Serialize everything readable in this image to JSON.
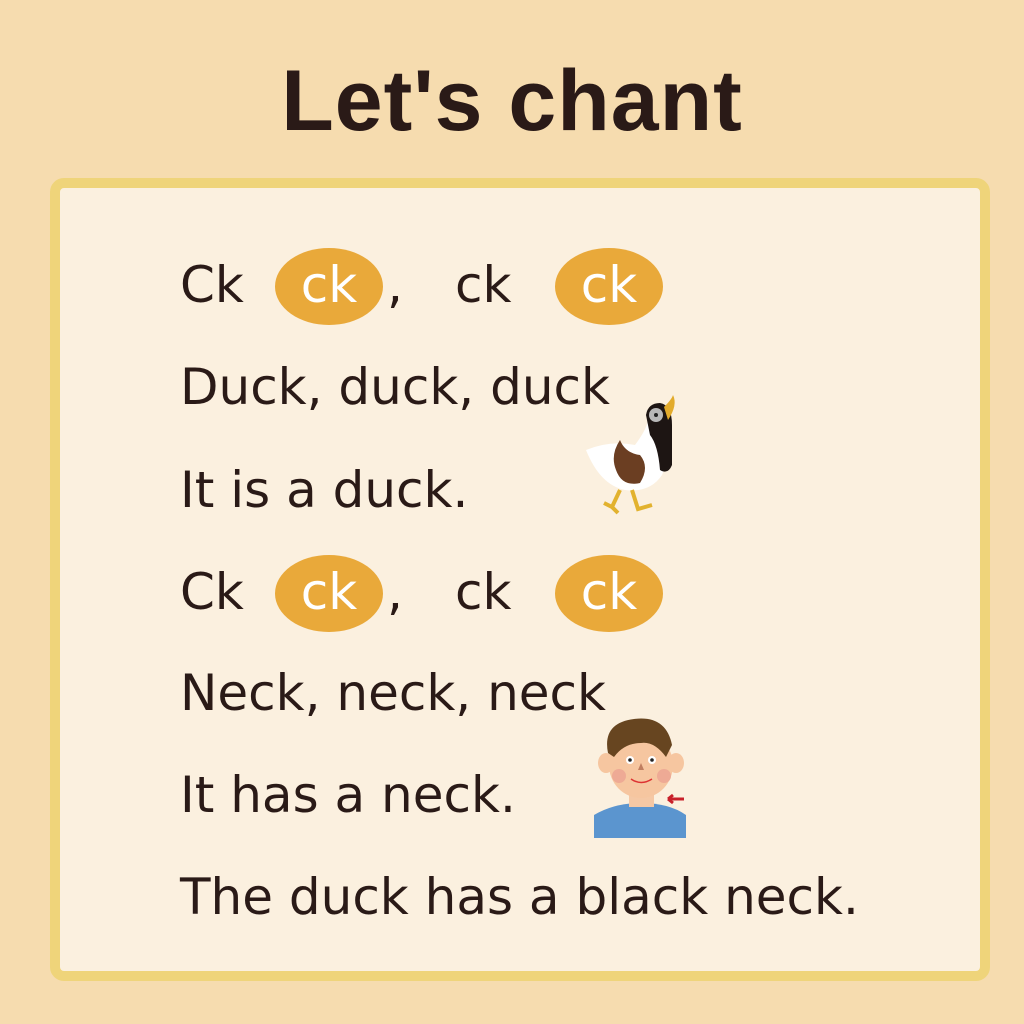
{
  "title": "Let's chant",
  "colors": {
    "background": "#f6dcaf",
    "panel": "#fbf0df",
    "border": "#efd47a",
    "highlight": "#e9a93a",
    "text": "#2a1a17"
  },
  "lines": [
    {
      "parts": [
        "Ck",
        "ck",
        ",",
        "ck",
        "ck"
      ]
    },
    {
      "text": "Duck, duck, duck"
    },
    {
      "text": "It is a duck."
    },
    {
      "parts": [
        "Ck",
        "ck",
        ",",
        "ck",
        "ck"
      ]
    },
    {
      "text": "Neck, neck, neck"
    },
    {
      "text": "It has a neck."
    },
    {
      "text": "The duck has a black neck."
    }
  ]
}
